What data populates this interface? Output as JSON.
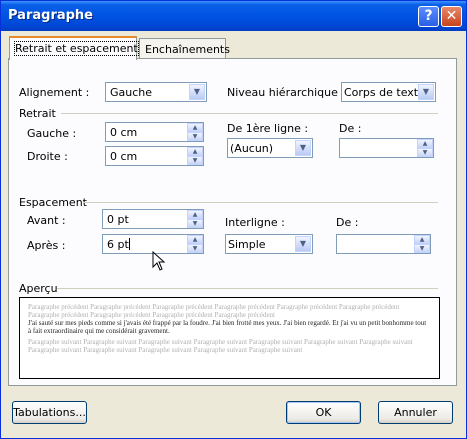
{
  "window": {
    "title": "Paragraphe"
  },
  "title_buttons": {
    "help": "?",
    "close": "✕"
  },
  "tabs": [
    {
      "label": "Retrait et espacement",
      "active": true
    },
    {
      "label": "Enchaînements",
      "active": false
    }
  ],
  "general": {
    "alignment_label": "Alignement :",
    "alignment_value": "Gauche",
    "outline_label": "Niveau hiérarchique :",
    "outline_value": "Corps de texte"
  },
  "indent": {
    "group_label": "Retrait",
    "left_label": "Gauche :",
    "left_value": "0 cm",
    "right_label": "Droite :",
    "right_value": "0 cm",
    "special_label": "De 1ère ligne :",
    "special_value": "(Aucun)",
    "by_label": "De :",
    "by_value": ""
  },
  "spacing": {
    "group_label": "Espacement",
    "before_label": "Avant :",
    "before_value": "0 pt",
    "after_label": "Après :",
    "after_value": "6 pt",
    "line_label": "Interligne :",
    "line_value": "Simple",
    "at_label": "De :",
    "at_value": ""
  },
  "preview": {
    "group_label": "Aperçu",
    "prev_text": "Paragraphe précédent Paragraphe précédent Paragraphe précédent Paragraphe précédent Paragraphe précédent Paragraphe précédent Paragraphe précédent Paragraphe précédent Paragraphe précédent Paragraphe précédent",
    "current_text": "J'ai sauté sur mes pieds comme si j'avais été frappé par la foudre. J'ai bien frotté mes yeux. J'ai bien regardé. Et j'ai vu un petit bonhomme tout à fait extraordinaire qui me considérait gravement.",
    "next_text": "Paragraphe suivant Paragraphe suivant Paragraphe suivant Paragraphe suivant Paragraphe suivant Paragraphe suivant Paragraphe suivant Paragraphe suivant Paragraphe suivant Paragraphe suivant Paragraphe suivant Paragraphe suivant"
  },
  "buttons": {
    "tabs_label": "Tabulations...",
    "ok_label": "OK",
    "cancel_label": "Annuler"
  },
  "icons": {
    "spin_up": "▲",
    "spin_down": "▼",
    "dropdown": "▼"
  }
}
